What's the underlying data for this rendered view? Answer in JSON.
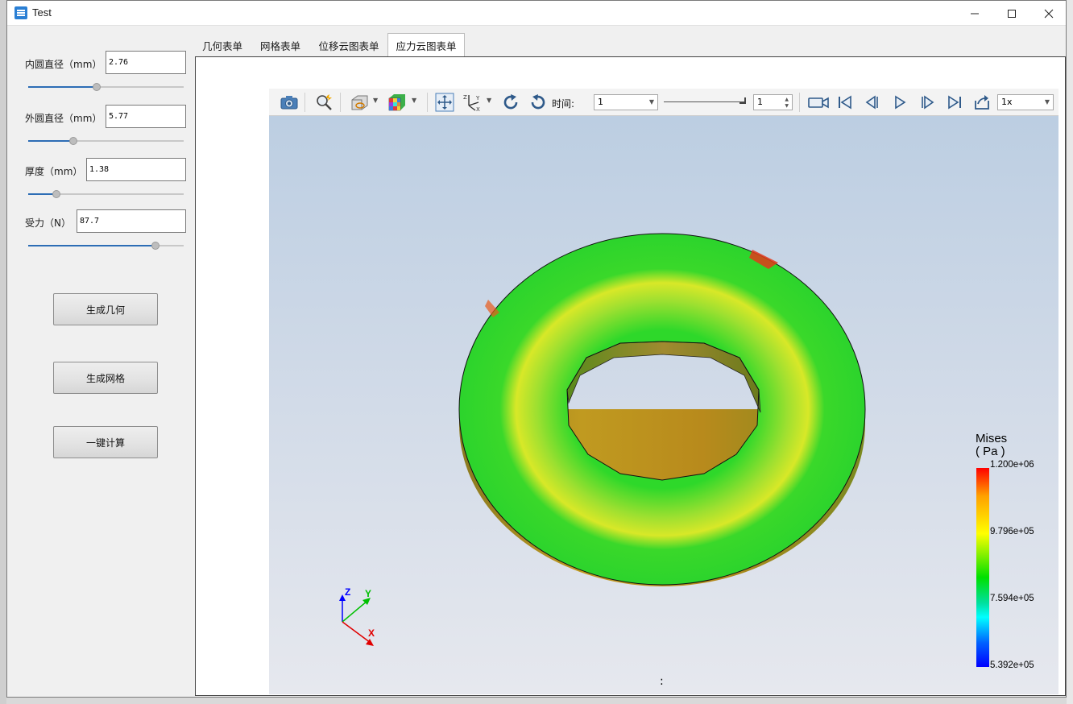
{
  "window": {
    "title": "Test"
  },
  "params": [
    {
      "label": "内圆直径（mm）",
      "value": "2.76",
      "slider": 0.44
    },
    {
      "label": "外圆直径（mm）",
      "value": "5.77",
      "slider": 0.29
    },
    {
      "label": "厚度（mm）",
      "value": "1.38",
      "slider": 0.18
    },
    {
      "label": "受力（N）",
      "value": "87.7",
      "slider": 0.82
    }
  ],
  "buttons": {
    "gen_geometry": "生成几何",
    "gen_mesh": "生成网格",
    "one_click": "一键计算"
  },
  "tabs": [
    {
      "label": "几何表单",
      "active": false
    },
    {
      "label": "网格表单",
      "active": false
    },
    {
      "label": "位移云图表单",
      "active": false
    },
    {
      "label": "应力云图表单",
      "active": true
    }
  ],
  "viewer_toolbar": {
    "time_label": "时间:",
    "time_combo": "1",
    "time_spin": "1",
    "speed_combo": "1x",
    "icons": [
      "camera-icon",
      "zoom-icon",
      "display-style-icon",
      "color-cube-icon",
      "fit-view-icon",
      "axes-icon",
      "rotate-cw-icon",
      "rotate-ccw-icon",
      "record-icon",
      "first-frame-icon",
      "prev-frame-icon",
      "play-icon",
      "next-frame-icon",
      "last-frame-icon",
      "export-icon"
    ]
  },
  "legend": {
    "title_line1": "Mises",
    "title_line2": "( Pa )",
    "values": [
      "1.200e+06",
      "9.796e+05",
      "7.594e+05",
      "5.392e+05"
    ]
  },
  "triad": {
    "x": "X",
    "y": "Y",
    "z": "Z"
  },
  "footer": ":",
  "colors": {
    "accent": "#2d6db5",
    "stress_high": "#ff0000",
    "stress_mid": "#ffff00",
    "stress_low": "#0000ff",
    "ring_green": "#2cd62c"
  }
}
